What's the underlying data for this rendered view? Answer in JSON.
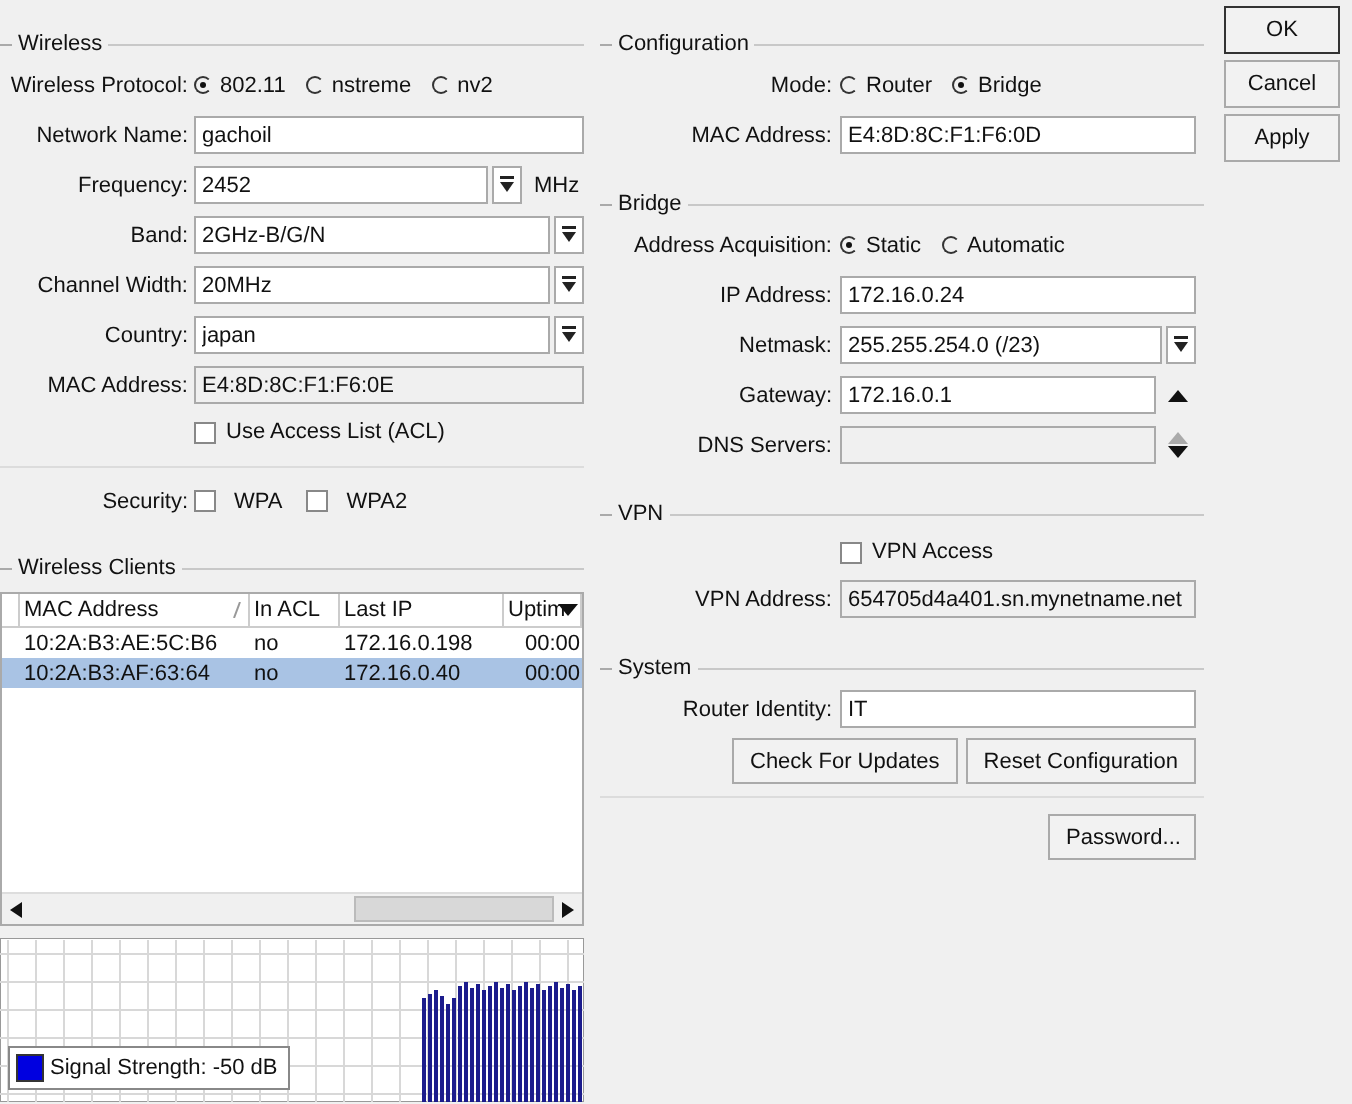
{
  "wireless": {
    "title": "Wireless",
    "protocol": {
      "label": "Wireless Protocol:",
      "options": [
        {
          "label": "802.11",
          "selected": true
        },
        {
          "label": "nstreme",
          "selected": false
        },
        {
          "label": "nv2",
          "selected": false
        }
      ]
    },
    "fields": [
      {
        "kind": "text",
        "label": "Network Name:",
        "value": "gachoil"
      },
      {
        "kind": "combo",
        "label": "Frequency:",
        "value": "2452",
        "unit": "MHz"
      },
      {
        "kind": "combo",
        "label": "Band:",
        "value": "2GHz-B/G/N"
      },
      {
        "kind": "combo",
        "label": "Channel Width:",
        "value": "20MHz"
      },
      {
        "kind": "combo",
        "label": "Country:",
        "value": "japan"
      },
      {
        "kind": "readonly",
        "label": "MAC Address:",
        "value": "E4:8D:8C:F1:F6:0E"
      }
    ],
    "acl": {
      "label": "Use Access List (ACL)",
      "checked": false
    },
    "security": {
      "label": "Security:",
      "options": [
        {
          "label": "WPA",
          "checked": false
        },
        {
          "label": "WPA2",
          "checked": false
        }
      ]
    }
  },
  "clients": {
    "title": "Wireless Clients",
    "columns": [
      "MAC Address",
      "In ACL",
      "Last IP",
      "Uptim"
    ],
    "rows": [
      {
        "cells": [
          "10:2A:B3:AE:5C:B6",
          "no",
          "172.16.0.198",
          "00:00"
        ],
        "selected": false
      },
      {
        "cells": [
          "10:2A:B3:AF:63:64",
          "no",
          "172.16.0.40",
          "00:00"
        ],
        "selected": true
      }
    ]
  },
  "signal": {
    "legend": "Signal Strength: -50 dB"
  },
  "configuration": {
    "title": "Configuration",
    "mode": {
      "label": "Mode:",
      "options": [
        {
          "label": "Router",
          "selected": false
        },
        {
          "label": "Bridge",
          "selected": true
        }
      ]
    },
    "fields": [
      {
        "kind": "text",
        "label": "MAC Address:",
        "value": "E4:8D:8C:F1:F6:0D"
      }
    ]
  },
  "bridge": {
    "title": "Bridge",
    "acquisition": {
      "label": "Address Acquisition:",
      "options": [
        {
          "label": "Static",
          "selected": true
        },
        {
          "label": "Automatic",
          "selected": false
        }
      ]
    },
    "fields": [
      {
        "kind": "text",
        "label": "IP Address:",
        "value": "172.16.0.24"
      },
      {
        "kind": "combo",
        "label": "Netmask:",
        "value": "255.255.254.0 (/23)"
      },
      {
        "kind": "add",
        "label": "Gateway:",
        "value": "172.16.0.1"
      },
      {
        "kind": "list",
        "label": "DNS Servers:"
      }
    ]
  },
  "vpn": {
    "title": "VPN",
    "access": {
      "label": "VPN Access",
      "checked": false
    },
    "fields": [
      {
        "kind": "readonly",
        "label": "VPN Address:",
        "value": "654705d4a401.sn.mynetname.net"
      }
    ]
  },
  "system": {
    "title": "System",
    "fields": [
      {
        "kind": "text",
        "label": "Router Identity:",
        "value": "IT"
      }
    ],
    "buttons": [
      "Check For Updates",
      "Reset Configuration"
    ],
    "password_button": "Password..."
  },
  "dialog_buttons": [
    {
      "label": "OK",
      "default": true
    },
    {
      "label": "Cancel",
      "default": false
    },
    {
      "label": "Apply",
      "default": false
    }
  ]
}
